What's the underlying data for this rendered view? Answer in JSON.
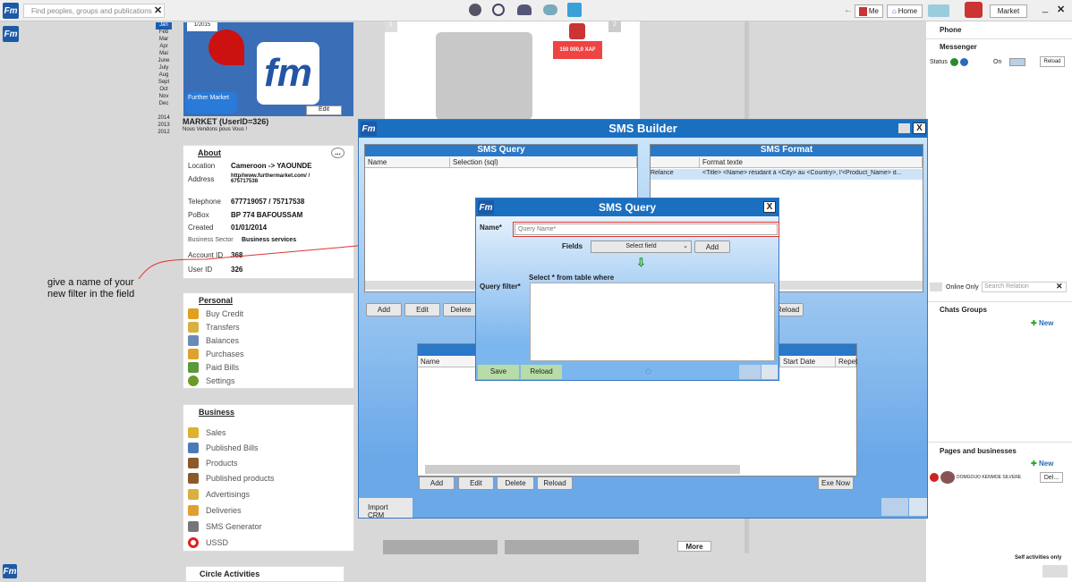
{
  "topbar": {
    "search_placeholder": "Find peoples, groups and publications",
    "me": "Me",
    "home": "Home",
    "market": "Market",
    "logo": "Fm"
  },
  "months": [
    "Jan",
    "Feb",
    "Mar",
    "Apr",
    "Mai",
    "June",
    "July",
    "Aug",
    "Sept",
    "Oct",
    "Nov",
    "Dec"
  ],
  "years": [
    "2014",
    "2013",
    "2012"
  ],
  "profile": {
    "date_badge": "1/2015",
    "edit": "Edit",
    "name": "MARKET (UserID=326)",
    "slogan": "Nous Vendons pous Vous !",
    "logo_text": "Further Market"
  },
  "about": {
    "title": "About",
    "more": "...",
    "location_label": "Location",
    "location": "Cameroon -> YAOUNDE",
    "address_label": "Address",
    "address": "http//www.furthermarket.com/ / 675717538",
    "telephone_label": "Telephone",
    "telephone": "677719057 / 75717538",
    "pobox_label": "PoBox",
    "pobox": "BP 774 BAFOUSSAM",
    "created_label": "Created",
    "created": "01/01/2014",
    "sector_label": "Business Sector",
    "sector": "Business services",
    "account_label": "Account ID",
    "account": "368",
    "userid_label": "User ID",
    "userid": "326"
  },
  "annotation": "give a name of your new filter in the field",
  "personal": {
    "title": "Personal",
    "items": [
      "Buy Credit",
      "Transfers",
      "Balances",
      "Purchases",
      "Paid Bills",
      "Settings"
    ]
  },
  "business": {
    "title": "Business",
    "items": [
      "Sales",
      "Published Bills",
      "Products",
      "Published products",
      "Advertisings",
      "Deliveries",
      "SMS Generator",
      "USSD"
    ]
  },
  "circle": "Circle Activities",
  "product": {
    "badge1": "1",
    "badge2": "2",
    "price": "150 000,0 XAF"
  },
  "more": "More",
  "right": {
    "phone": "Phone",
    "messenger": "Messenger",
    "status": "Status",
    "on": "On",
    "reload": "Reload",
    "online_only": "Online Only",
    "search_relation": "Search Relation",
    "chats": "Chats Groups",
    "new": "New",
    "pages": "Pages and businesses",
    "new2": "New",
    "contact": "DOMGOUO KENMOE SILVERE",
    "del": "Del...",
    "self": "Self activities only"
  },
  "builder": {
    "title": "SMS Builder",
    "query_title": "SMS Query",
    "format_title": "SMS Format",
    "col_name": "Name",
    "col_selection": "Selection (sql)",
    "col_format": "Format texte",
    "row_name": "Relance",
    "row_format": "<Title>  <Name> résidant à <City> au <Country>, l'<Product_Name> d...",
    "add": "Add",
    "edit": "Edit",
    "delete": "Delete",
    "reload": "Reload",
    "col_name2": "Name",
    "col_start": "Start Date",
    "col_repeat": "Repet",
    "add2": "Add",
    "edit2": "Edit",
    "delete2": "Delete",
    "reload2": "Reload",
    "exe": "Exe Now",
    "import": "Import CRM",
    "close": "X"
  },
  "dialog": {
    "title": "SMS Query",
    "close": "X",
    "name_label": "Name*",
    "name_placeholder": "Query Name*",
    "fields_label": "Fields",
    "select_field": "Select field",
    "add": "Add",
    "select_stmt": "Select * from table where",
    "filter_label": "Query filter*",
    "save": "Save",
    "reload": "Reload"
  }
}
